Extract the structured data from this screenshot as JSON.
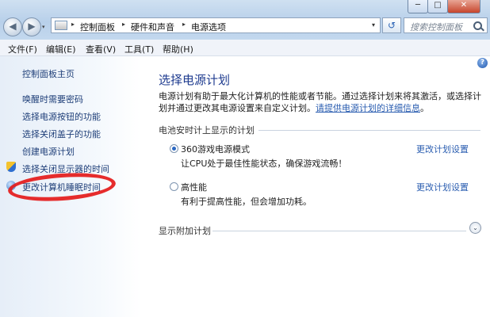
{
  "window": {
    "controls": [
      "─",
      "□",
      "✕"
    ]
  },
  "nav": {
    "back_glyph": "◀",
    "forward_glyph": "▶",
    "history_glyph": "▾",
    "refresh_glyph": "↺"
  },
  "address": {
    "separator": "▸",
    "breadcrumbs": [
      "控制面板",
      "硬件和声音",
      "电源选项"
    ],
    "dropdown_glyph": "▾"
  },
  "search": {
    "placeholder": "搜索控制面板"
  },
  "menu": {
    "items": [
      "文件(F)",
      "编辑(E)",
      "查看(V)",
      "工具(T)",
      "帮助(H)"
    ]
  },
  "sidebar": {
    "home": "控制面板主页",
    "links": [
      "唤醒时需要密码",
      "选择电源按钮的功能",
      "选择关闭盖子的功能",
      "创建电源计划",
      "选择关闭显示器的时间",
      "更改计算机睡眠时间"
    ]
  },
  "main": {
    "help_glyph": "?",
    "title": "选择电源计划",
    "description": "电源计划有助于最大化计算机的性能或者节能。通过选择计划来将其激活，或选择计划并通过更改其电源设置来自定义计划。",
    "description_link": "请提供电源计划的详细信息",
    "description_end": "。",
    "group_title": "电池安时计上显示的计划",
    "plans": [
      {
        "name": "360游戏电源模式",
        "desc": "让CPU处于最佳性能状态，确保游戏流畅！",
        "link": "更改计划设置",
        "selected": true
      },
      {
        "name": "高性能",
        "desc": "有利于提高性能，但会增加功耗。",
        "link": "更改计划设置",
        "selected": false
      }
    ],
    "more_plans": "显示附加计划",
    "expand_glyph": "⌄"
  },
  "colors": {
    "link": "#2a5db0",
    "title": "#1e3b8f",
    "annotation": "#e41a1a"
  }
}
